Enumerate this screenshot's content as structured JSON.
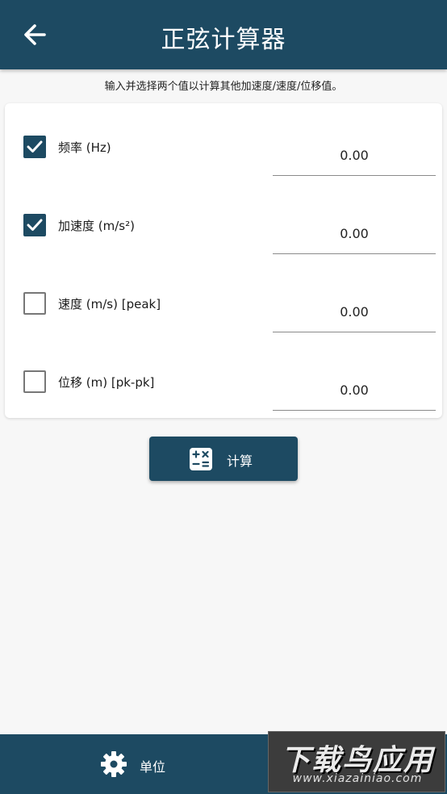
{
  "header": {
    "title": "正弦计算器",
    "back_icon": "arrow-left-icon"
  },
  "hint": "输入并选择两个值以计算其他加速度/速度/位移值。",
  "rows": [
    {
      "label": "频率 (Hz)",
      "value": "0.00",
      "checked": true
    },
    {
      "label": "加速度 (m/s²)",
      "value": "0.00",
      "checked": true
    },
    {
      "label": "速度 (m/s) [peak]",
      "value": "0.00",
      "checked": false
    },
    {
      "label": "位移 (m) [pk-pk]",
      "value": "0.00",
      "checked": false
    }
  ],
  "calculate": {
    "label": "计算",
    "icon": "calculator-icon"
  },
  "bottom_nav": {
    "units_label": "单位",
    "units_icon": "gear-icon"
  },
  "watermark": {
    "main": "下载鸟应用",
    "sub": "www.xiazainiao.com"
  },
  "colors": {
    "primary": "#1d4a62",
    "background": "#f7f7f7",
    "card": "#ffffff"
  }
}
